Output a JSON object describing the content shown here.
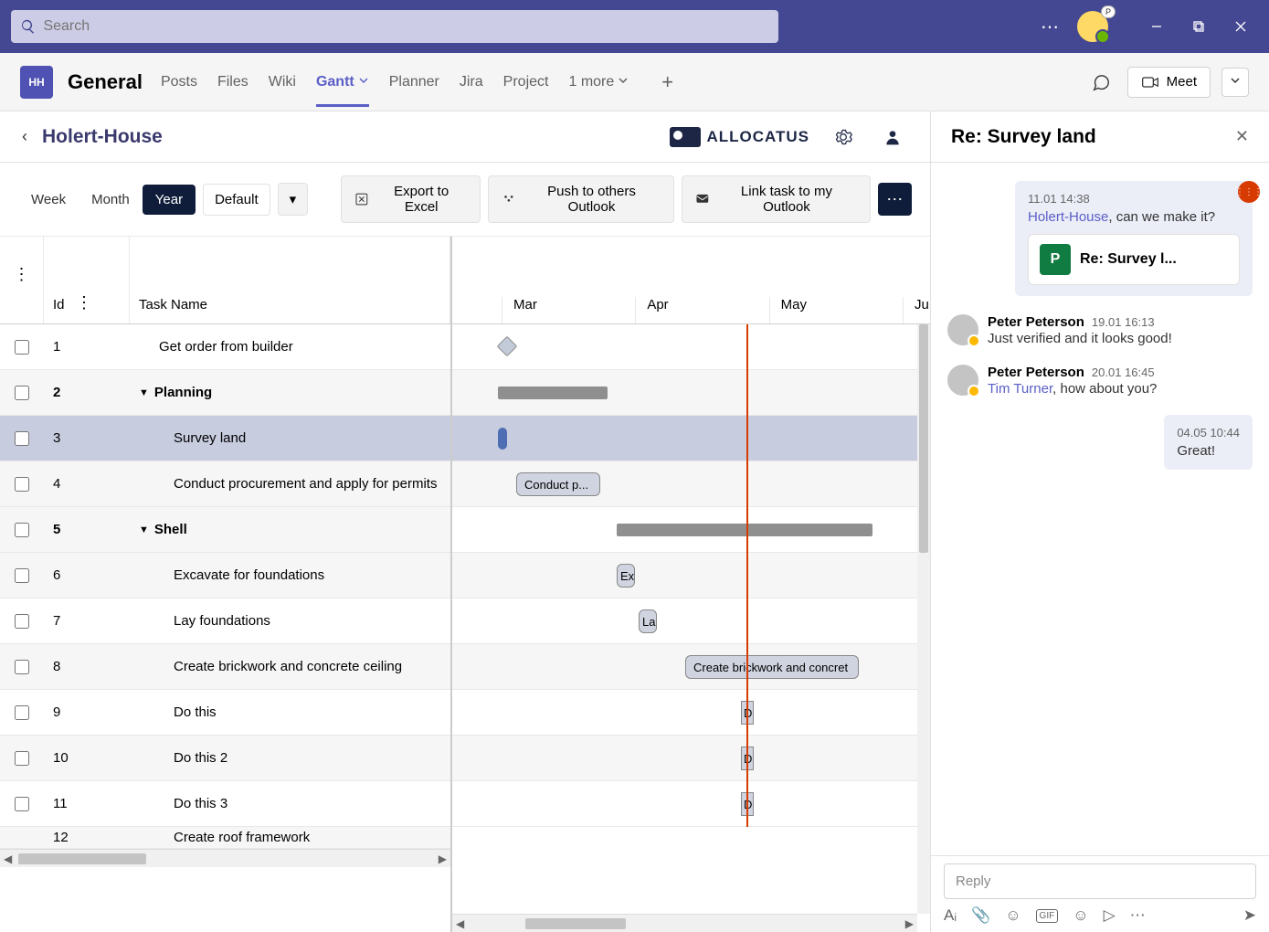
{
  "search": {
    "placeholder": "Search"
  },
  "avatar": {
    "badge": "P"
  },
  "channel": {
    "icon": "HH",
    "name": "General",
    "tabs": [
      "Posts",
      "Files",
      "Wiki",
      "Gantt",
      "Planner",
      "Jira",
      "Project",
      "1 more"
    ],
    "active_tab": "Gantt",
    "meet": "Meet"
  },
  "gantt": {
    "breadcrumb": "Holert-House",
    "brand": "ALLOCATUS",
    "views": [
      "Week",
      "Month",
      "Year"
    ],
    "active_view": "Year",
    "default_label": "Default",
    "toolbar": {
      "export": "Export to Excel",
      "push": "Push to others Outlook",
      "link": "Link task to my Outlook"
    },
    "columns": {
      "id": "Id",
      "name": "Task Name"
    },
    "months": [
      "Mar",
      "Apr",
      "May",
      "Ju"
    ],
    "tasks": [
      {
        "id": "1",
        "name": "Get order from builder",
        "type": "milestone",
        "indent": 1
      },
      {
        "id": "2",
        "name": "Planning",
        "type": "group",
        "indent": 0
      },
      {
        "id": "3",
        "name": "Survey land",
        "type": "task",
        "indent": 2,
        "selected": true
      },
      {
        "id": "4",
        "name": "Conduct procurement and apply for permits",
        "type": "task",
        "indent": 2,
        "bar_label": "Conduct p..."
      },
      {
        "id": "5",
        "name": "Shell",
        "type": "group",
        "indent": 0
      },
      {
        "id": "6",
        "name": "Excavate for foundations",
        "type": "task",
        "indent": 2,
        "bar_label": "Ex"
      },
      {
        "id": "7",
        "name": "Lay foundations",
        "type": "task",
        "indent": 2,
        "bar_label": "La"
      },
      {
        "id": "8",
        "name": "Create brickwork and concrete ceiling",
        "type": "task",
        "indent": 2,
        "bar_label": "Create brickwork and concret"
      },
      {
        "id": "9",
        "name": "Do this",
        "type": "task",
        "indent": 2,
        "bar_label": "D"
      },
      {
        "id": "10",
        "name": "Do this 2",
        "type": "task",
        "indent": 2,
        "bar_label": "D"
      },
      {
        "id": "11",
        "name": "Do this 3",
        "type": "task",
        "indent": 2,
        "bar_label": "D"
      },
      {
        "id": "12",
        "name": "Create roof framework",
        "type": "task",
        "indent": 2
      }
    ]
  },
  "chat": {
    "title": "Re: Survey land",
    "messages": [
      {
        "kind": "right",
        "time": "11.01 14:38",
        "link": "Holert-House",
        "text": ", can we make it?",
        "card": "Re: Survey l..."
      },
      {
        "kind": "left",
        "author": "Peter Peterson",
        "time": "19.01 16:13",
        "text": "Just verified and it looks good!"
      },
      {
        "kind": "left",
        "author": "Peter Peterson",
        "time": "20.01 16:45",
        "link": "Tim Turner",
        "text": ", how about you?"
      },
      {
        "kind": "right",
        "time": "04.05 10:44",
        "text": "Great!"
      }
    ],
    "reply_placeholder": "Reply"
  }
}
